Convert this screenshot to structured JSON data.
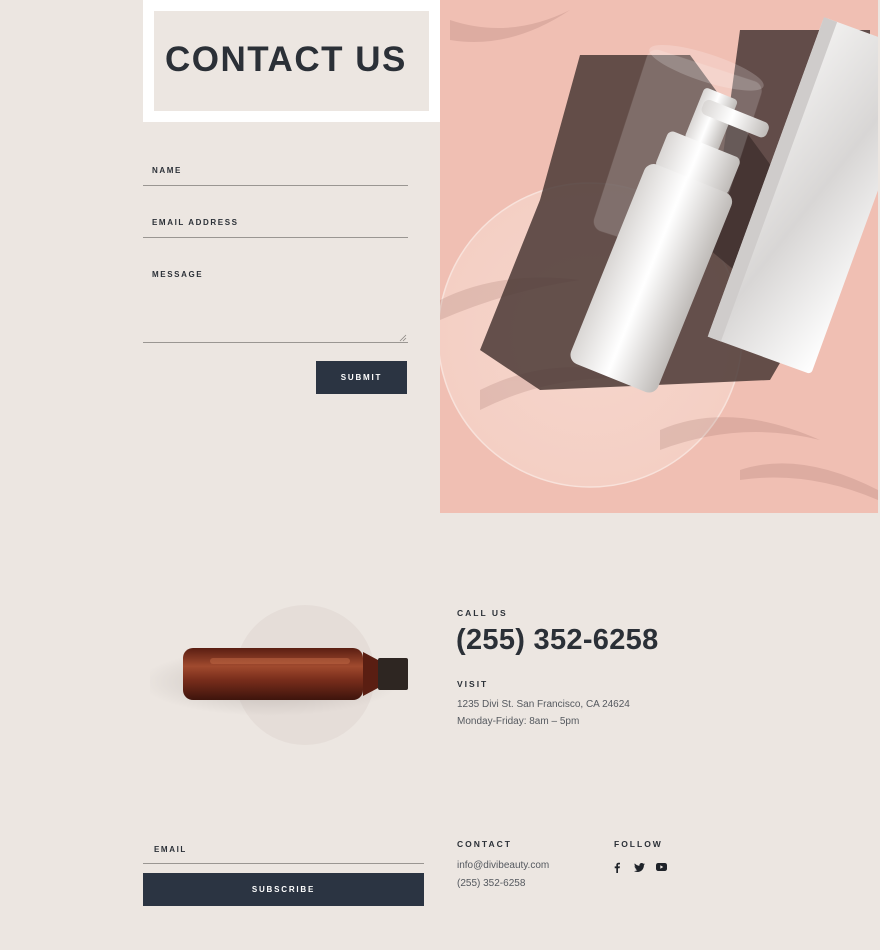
{
  "header": {
    "title": "CONTACT US"
  },
  "form": {
    "name_label": "NAME",
    "email_label": "EMAIL ADDRESS",
    "message_label": "MESSAGE",
    "submit_label": "SUBMIT"
  },
  "contact_info": {
    "call_label": "CALL US",
    "phone": "(255) 352-6258",
    "visit_label": "VISIT",
    "address": "1235 Divi St. San Francisco, CA 24624",
    "hours": "Monday-Friday: 8am – 5pm"
  },
  "footer": {
    "email_label": "EMAIL",
    "subscribe_label": "SUBSCRIBE",
    "contact_heading": "CONTACT",
    "contact_email": "info@divibeauty.com",
    "contact_phone": "(255) 352-6258",
    "follow_heading": "FOLLOW",
    "social_icons": [
      "facebook-icon",
      "twitter-icon",
      "youtube-icon"
    ]
  },
  "colors": {
    "background": "#ece6e1",
    "dark": "#2b3442",
    "hero_pink": "#f0bfb3",
    "bottle_amber": "#7a2e1c"
  }
}
